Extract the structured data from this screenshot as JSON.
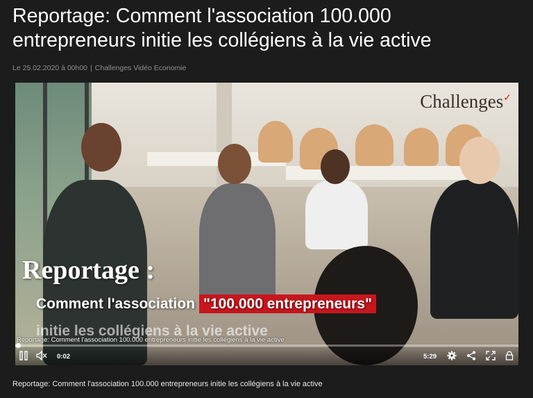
{
  "article": {
    "title": "Reportage: Comment l'association 100.000 entrepreneurs initie les collégiens à la vie active",
    "date": "Le 25.02.2020 à 00h00",
    "source": "Challenges Vidéo Economie",
    "separator": "|"
  },
  "video": {
    "logo_text": "Challenges",
    "overlay_title": "Reportage :",
    "overlay_line2_prefix": "Comment l'association",
    "overlay_line2_highlight": "\"100.000 entrepreneurs\"",
    "overlay_line3": "initie les collégiens à la vie active",
    "caption_bar": "Reportage: Comment l'association 100.000 entrepreneurs initie les collégiens à la vie active",
    "current_time": "0:02",
    "duration": "5:29",
    "progress_fraction": 0.006,
    "highlight_color": "#c8161d"
  },
  "controls": {
    "icons": [
      "pause-icon",
      "volume-muted-icon",
      "settings-icon",
      "share-icon",
      "fullscreen-icon",
      "lock-icon"
    ]
  },
  "footer": {
    "caption": "Reportage: Comment l'association 100.000 entrepreneurs initie les collégiens à la vie active"
  }
}
